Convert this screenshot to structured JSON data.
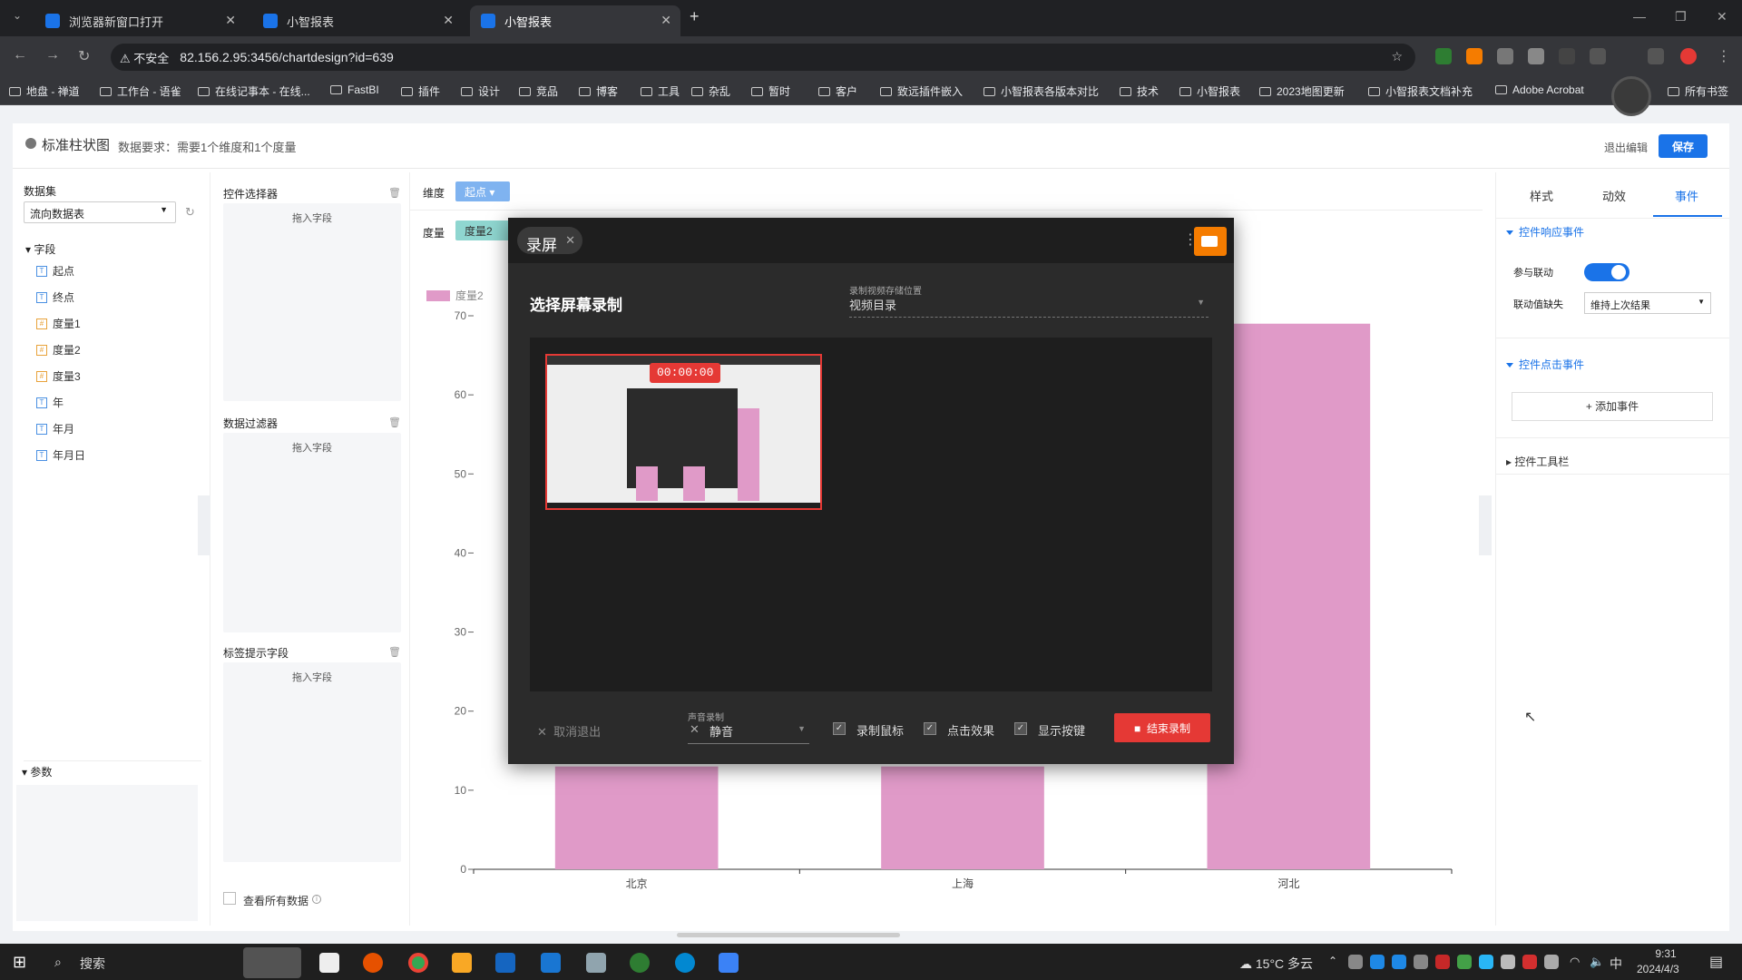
{
  "browser": {
    "tabs": [
      {
        "title": "浏览器新窗口打开",
        "active": false
      },
      {
        "title": "小智报表",
        "active": false
      },
      {
        "title": "小智报表",
        "active": true
      }
    ],
    "url": "82.156.2.95:3456/chartdesign?id=639",
    "insecure_label": "不安全",
    "bookmarks": [
      "地盘 - 禅道",
      "工作台 - 语雀",
      "在线记事本 - 在线...",
      "FastBI",
      "插件",
      "设计",
      "竞品",
      "博客",
      "工具",
      "杂乱",
      "暂时",
      "客户",
      "致远插件嵌入",
      "小智报表各版本对比",
      "技术",
      "小智报表",
      "2023地图更新",
      "小智报表文档补充",
      "Adobe Acrobat",
      "所有书签"
    ]
  },
  "header": {
    "title": "标准柱状图",
    "requirement": "数据要求：需要1个维度和1个度量",
    "exit_label": "退出编辑",
    "save_label": "保存"
  },
  "left": {
    "dataset_label": "数据集",
    "dataset_value": "流向数据表",
    "fields_label": "字段",
    "fields": [
      {
        "name": "起点",
        "kind": "dim"
      },
      {
        "name": "终点",
        "kind": "dim"
      },
      {
        "name": "度量1",
        "kind": "measure"
      },
      {
        "name": "度量2",
        "kind": "measure"
      },
      {
        "name": "度量3",
        "kind": "measure"
      },
      {
        "name": "年",
        "kind": "dim"
      },
      {
        "name": "年月",
        "kind": "dim"
      },
      {
        "name": "年月日",
        "kind": "dim"
      }
    ],
    "params_label": "参数"
  },
  "mid": {
    "control_selector": "控件选择器",
    "data_filter": "数据过滤器",
    "label_tip_field": "标签提示字段",
    "drop_hint": "拖入字段",
    "view_all_data": "查看所有数据"
  },
  "shelf": {
    "dimension_label": "维度",
    "dimension_chip": "起点",
    "measure_label": "度量",
    "measure_chip": "度量2"
  },
  "chart_data": {
    "type": "bar",
    "categories": [
      "北京",
      "上海",
      "河北"
    ],
    "series": [
      {
        "name": "度量2",
        "values": [
          13,
          13,
          69
        ],
        "color": "#e09ac8"
      }
    ],
    "ylim": [
      0,
      70
    ],
    "yticks": [
      0,
      10,
      20,
      30,
      40,
      50,
      60,
      70
    ],
    "legend": "top-left",
    "grid": false
  },
  "right": {
    "tabs": [
      "样式",
      "动效",
      "事件"
    ],
    "active_tab": "事件",
    "response_event": "控件响应事件",
    "link_label": "参与联动",
    "link_on": true,
    "missing_label": "联动值缺失",
    "missing_value": "维持上次结果",
    "click_event": "控件点击事件",
    "add_event": "添加事件",
    "toolbar": "控件工具栏"
  },
  "recorder": {
    "tab_title": "录屏",
    "heading": "选择屏幕录制",
    "save_loc_label": "录制视频存储位置",
    "save_loc_value": "视频目录",
    "timer": "00:00:00",
    "cancel": "取消退出",
    "audio_label": "声音录制",
    "audio_value": "静音",
    "opt_mouse": "录制鼠标",
    "opt_click": "点击效果",
    "opt_keys": "显示按键",
    "stop": "结束录制"
  },
  "taskbar": {
    "search": "搜索",
    "weather": "15°C 多云",
    "ime": "中",
    "time": "9:31",
    "date": "2024/4/3"
  },
  "colors": {
    "accent": "#1a73e8",
    "bar": "#e09ac8",
    "record_red": "#e53935"
  }
}
